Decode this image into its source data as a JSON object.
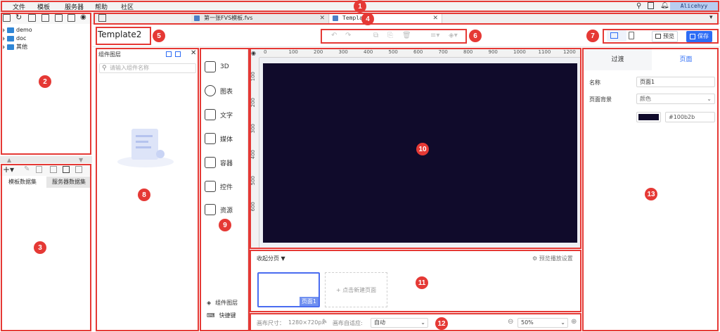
{
  "menu": {
    "items": [
      "文件",
      "模板",
      "服务器",
      "帮助",
      "社区"
    ],
    "user": "Alicehyy"
  },
  "tree": {
    "items": [
      "demo",
      "doc",
      "其他"
    ]
  },
  "datasets": {
    "tabs": [
      "模板数据集",
      "服务器数据集"
    ]
  },
  "file_tabs": [
    {
      "label": "第一张FVS模板.fvs",
      "active": false
    },
    {
      "label": "Template2",
      "active": true
    }
  ],
  "template_name": "Template2",
  "toolbar": {
    "preview_label": "预览",
    "save_label": "保存"
  },
  "layers": {
    "title": "组件图层",
    "search_placeholder": "请输入组件名称"
  },
  "categories": [
    "3D",
    "图表",
    "文字",
    "媒体",
    "容器",
    "控件",
    "资源"
  ],
  "cat_bottom": {
    "layers": "组件图层",
    "shortcuts": "快捷键"
  },
  "ruler": {
    "top": [
      "0",
      "100",
      "200",
      "300",
      "400",
      "500",
      "600",
      "700",
      "800",
      "900",
      "1000",
      "1100",
      "1200"
    ],
    "left": [
      "100",
      "200",
      "300",
      "400",
      "500",
      "600"
    ]
  },
  "pages": {
    "collapse": "收起分页",
    "autoplay_settings": "预览播放设置",
    "page1": "页面1",
    "new_page": "+ 点击新建页面"
  },
  "footer": {
    "canvas_size_label": "画布尺寸：",
    "canvas_size": "1280×720px",
    "adaptive_label": "画布自适应:",
    "adaptive_value": "自动",
    "zoom": "50%"
  },
  "props": {
    "tabs": [
      "过渡",
      "页面"
    ],
    "name_label": "名称",
    "name_value": "页面1",
    "bg_label": "页面背景",
    "bg_type": "颜色",
    "bg_color": "#100b2b"
  },
  "annotations": [
    "1",
    "2",
    "3",
    "4",
    "5",
    "6",
    "7",
    "8",
    "9",
    "10",
    "11",
    "12",
    "13"
  ],
  "colors": {
    "accent": "#2d6cf5",
    "annotation": "#e53935",
    "canvas": "#100b2b"
  }
}
